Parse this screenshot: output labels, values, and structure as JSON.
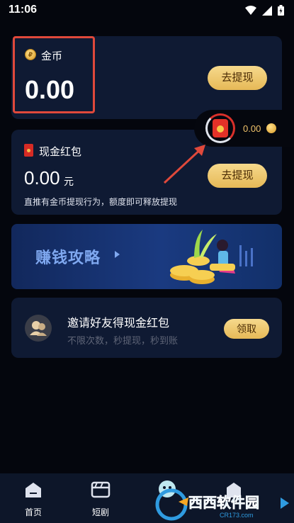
{
  "status_bar": {
    "time": "11:06"
  },
  "coin_card": {
    "coin_symbol": "₽",
    "label": "金币",
    "value": "0.00",
    "button": "去提现"
  },
  "cash_card": {
    "label": "现金红包",
    "value": "0.00",
    "unit": "元",
    "button": "去提现",
    "note": "直推有金币提现行为，额度即可释放提现"
  },
  "float_widget": {
    "value": "0.00"
  },
  "banner": {
    "title": "赚钱攻略"
  },
  "invite_card": {
    "title": "邀请好友得现金红包",
    "subtitle": "不限次数，秒提现，秒到账",
    "button": "领取"
  },
  "tabbar": {
    "items": [
      {
        "label": "首页",
        "icon": "home-icon"
      },
      {
        "label": "短剧",
        "icon": "clapperboard-icon"
      },
      {
        "label": "",
        "icon": "mascot-icon"
      },
      {
        "label": "",
        "icon": "profile-icon"
      }
    ]
  },
  "watermark": {
    "text": "西西软件园",
    "sub": "CR173.com"
  },
  "colors": {
    "accent_gold": "#f1c36b",
    "highlight_red": "#e0493b",
    "card_bg": "#0f1a33"
  }
}
